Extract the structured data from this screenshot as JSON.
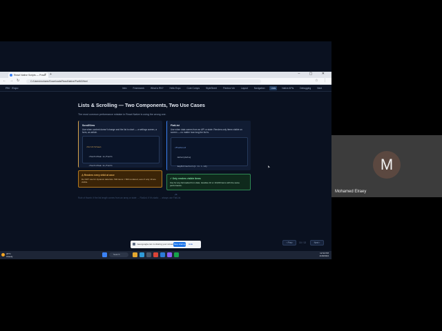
{
  "browser": {
    "tab_title": "React Native Scripts — Practi",
    "url": "C:/Users/mohamr/Downloads/ReactNative/Part5/2/html"
  },
  "app_nav": {
    "brand": "RN · Expo",
    "links": [
      "Intro",
      "Framework",
      "What is RN?",
      "Hello Expo",
      "Core Comps",
      "StyleSheet",
      "Flexbox Viz",
      "Layout",
      "Navigation",
      "Lists",
      "Native APIs",
      "Debugging",
      "Next"
    ],
    "active_index": 9
  },
  "content": {
    "title": "Lists & Scrolling — Two Components, Two Use Cases",
    "subtitle": "The most common performance mistake in React Native is using the wrong one.",
    "scrollview": {
      "title": "ScrollView",
      "desc": "Use when content doesn't change and the list is short — a settings screen, a form, an article.",
      "code": [
        "<ScrollView>",
        "  <Text>Item 1</Text>",
        "  <Text>Item 2</Text>",
        "  {/* renders ALL at once */}",
        "</ScrollView>"
      ]
    },
    "flatlist": {
      "title": "FlatList",
      "desc": "Use when data comes from an API or state. Renders only items visible on screen — no matter how long the list is.",
      "code": [
        "<FlatList",
        "  data={data}",
        "  keyExtractor={i => i.id}",
        "  renderItem={({ item }) =>",
        "    <Item title={item.title} />}",
        "/>"
      ]
    },
    "warning": {
      "title": "⚠ Renders every child at once",
      "body": "Do NOT use for dynamic data lists. 500 items = 500 rendered, even if only 10 are visible."
    },
    "tip": {
      "title": "✓ Only renders visible items",
      "body": "Use for any list loaded from data. Handles 10 or 10,000 items with the same performance."
    },
    "footnote": "Rule of thumb: if the list length comes from an array or state → FlatList. If it's static → always use FlatList.",
    "prev_label": "‹ Prev",
    "next_label": "Next ›",
    "page_count": "10 / 13"
  },
  "share_bar": {
    "text": "meet.google.com is sharing your screen.",
    "stop_label": "Stop sharing",
    "hide_label": "Hide"
  },
  "taskbar": {
    "weather_temp": "20°C",
    "weather_desc": "Cloudy",
    "search_placeholder": "Search",
    "time": "12:32 PM",
    "date": "4/18/2024"
  },
  "participant": {
    "initial": "M",
    "name": "Mohamed Elraey"
  }
}
